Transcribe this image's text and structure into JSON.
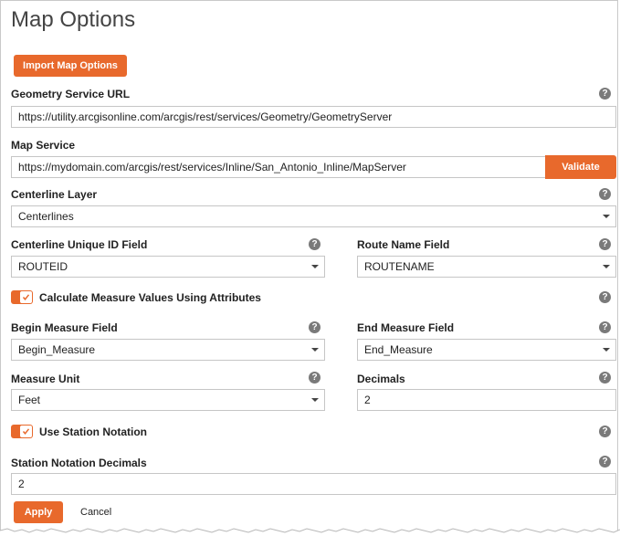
{
  "page": {
    "title": "Map Options"
  },
  "import_button": {
    "label": "Import Map Options"
  },
  "geometry_service": {
    "label": "Geometry Service URL",
    "value": "https://utility.arcgisonline.com/arcgis/rest/services/Geometry/GeometryServer"
  },
  "map_service": {
    "label": "Map Service",
    "value": "https://mydomain.com/arcgis/rest/services/Inline/San_Antonio_Inline/MapServer",
    "validate_label": "Validate"
  },
  "centerline_layer": {
    "label": "Centerline Layer",
    "value": "Centerlines"
  },
  "centerline_id_field": {
    "label": "Centerline Unique ID Field",
    "value": "ROUTEID"
  },
  "route_name_field": {
    "label": "Route Name Field",
    "value": "ROUTENAME"
  },
  "calc_measure": {
    "label": "Calculate Measure Values Using Attributes",
    "checked": true
  },
  "begin_measure_field": {
    "label": "Begin Measure Field",
    "value": "Begin_Measure"
  },
  "end_measure_field": {
    "label": "End Measure Field",
    "value": "End_Measure"
  },
  "measure_unit": {
    "label": "Measure Unit",
    "value": "Feet"
  },
  "decimals": {
    "label": "Decimals",
    "value": "2"
  },
  "station_notation": {
    "label": "Use Station Notation",
    "checked": true
  },
  "station_decimals": {
    "label": "Station Notation Decimals",
    "value": "2"
  },
  "footer": {
    "apply_label": "Apply",
    "cancel_label": "Cancel"
  },
  "help_glyph": "?",
  "colors": {
    "accent": "#e8692c",
    "help": "#7a7a7a",
    "border": "#c6c6c6"
  }
}
